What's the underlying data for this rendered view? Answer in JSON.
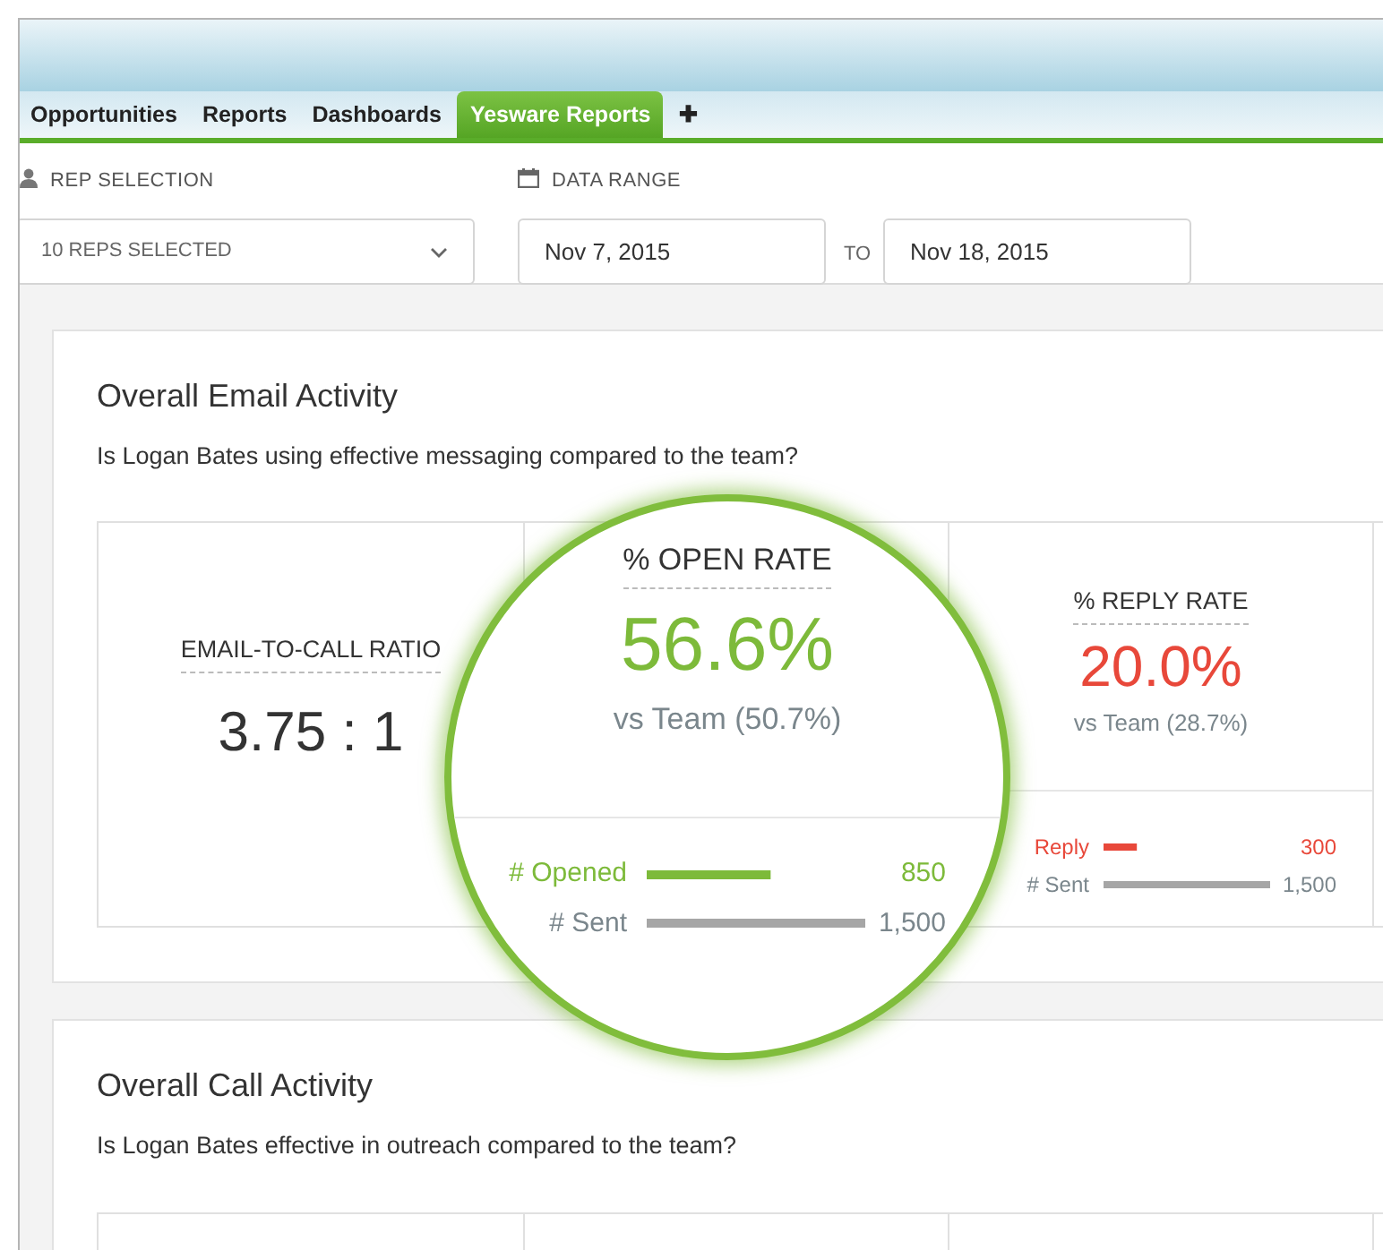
{
  "tabs": [
    {
      "label": "Opportunities",
      "selected": false
    },
    {
      "label": "Reports",
      "selected": false
    },
    {
      "label": "Dashboards",
      "selected": false
    },
    {
      "label": "Yesware Reports",
      "selected": true
    },
    {
      "label": "✚",
      "selected": false
    }
  ],
  "filters": {
    "rep_selection": {
      "label": "REP SELECTION",
      "value": "10 REPS SELECTED"
    },
    "date_range": {
      "label": "DATA RANGE",
      "from": "Nov 7, 2015",
      "separator": "TO",
      "to": "Nov 18, 2015"
    }
  },
  "sections": [
    {
      "title": "Overall Email Activity",
      "question": "Is Logan Bates using effective messaging compared to the team?",
      "metrics": [
        {
          "kind": "ratio",
          "label": "EMAIL-TO-CALL RATIO",
          "value": "3.75 : 1"
        },
        {
          "kind": "rate",
          "magnified": true,
          "label": "% OPEN RATE",
          "value": "56.6%",
          "color": "#7dba3a",
          "comparison": "vs Team (50.7%)",
          "bars": [
            {
              "label": "# Opened",
              "value": "850",
              "level": 0.567,
              "color": "#7dba3a"
            },
            {
              "label": "# Sent",
              "value": "1,500",
              "level": 1,
              "color": "#a6a6a6"
            }
          ]
        },
        {
          "kind": "rate",
          "magnified": false,
          "label": "% REPLY RATE",
          "value": "20.0%",
          "color": "#e8483a",
          "comparison": "vs Team (28.7%)",
          "bars": [
            {
              "label": "Reply",
              "value": "300",
              "level": 0.2,
              "color": "#e8483a"
            },
            {
              "label": "# Sent",
              "value": "1,500",
              "level": 1,
              "color": "#a6a6a6"
            }
          ]
        }
      ]
    },
    {
      "title": "Overall Call Activity",
      "question": "Is Logan Bates effective in outreach compared to the team?"
    }
  ]
}
